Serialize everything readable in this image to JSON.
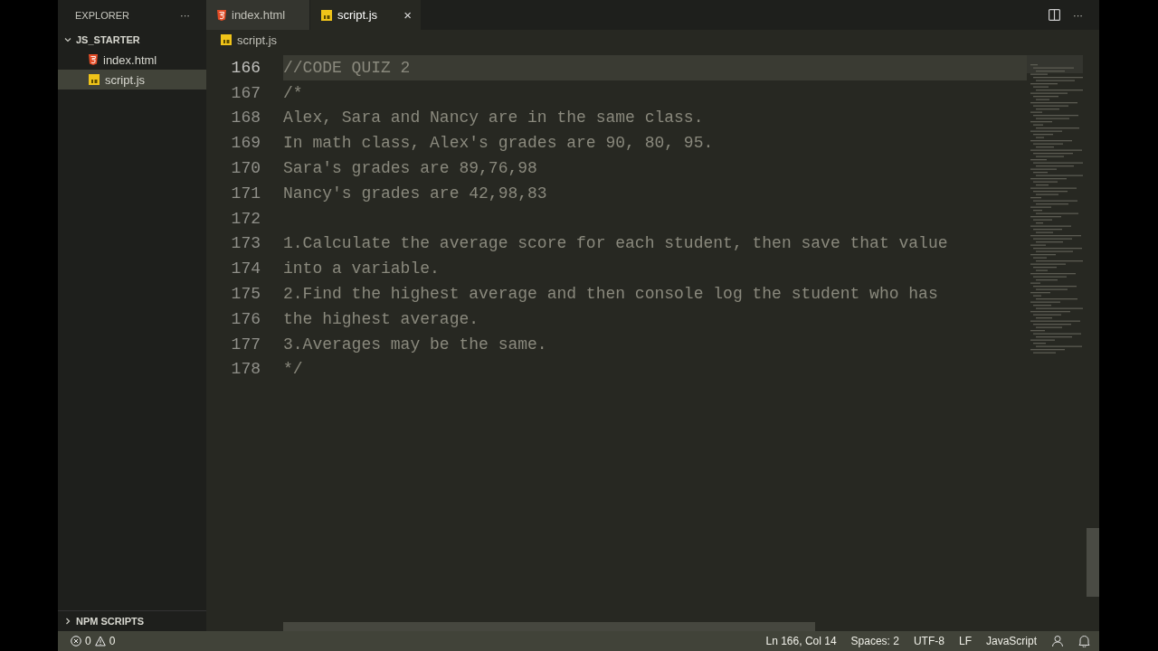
{
  "sidebar": {
    "title": "EXPLORER",
    "more": "···",
    "folder": {
      "name": "JS_STARTER",
      "expanded": true,
      "children": [
        {
          "name": "index.html",
          "kind": "html",
          "selected": false
        },
        {
          "name": "script.js",
          "kind": "js",
          "selected": true
        }
      ]
    },
    "npm_scripts": {
      "name": "NPM SCRIPTS",
      "expanded": false
    }
  },
  "tabs": [
    {
      "label": "index.html",
      "kind": "html",
      "selected": false
    },
    {
      "label": "script.js",
      "kind": "js",
      "selected": true,
      "close": "×"
    }
  ],
  "editor_actions": {
    "more": "···"
  },
  "breadcrumb": {
    "label": "script.js",
    "kind": "js"
  },
  "lines": [
    {
      "number": "166",
      "text": "//CODE QUIZ 2",
      "current": true
    },
    {
      "number": "167",
      "text": "/*",
      "current": false
    },
    {
      "number": "168",
      "text": "Alex, Sara and Nancy are in the same class.",
      "current": false
    },
    {
      "number": "169",
      "text": "In math class, Alex's grades are 90, 80, 95.",
      "current": false
    },
    {
      "number": "170",
      "text": "Sara's grades are 89,76,98",
      "current": false
    },
    {
      "number": "171",
      "text": "Nancy's grades are 42,98,83",
      "current": false
    },
    {
      "number": "172",
      "current": false
    },
    {
      "number": "173",
      "text": "1.Calculate the average score for each student, then save that value",
      "current": false
    },
    {
      "number": "174",
      "text": "into a variable.",
      "current": false
    },
    {
      "number": "175",
      "text": "2.Find the highest average and then console log the student who has",
      "current": false
    },
    {
      "number": "176",
      "text": "the highest average.",
      "current": false
    },
    {
      "number": "177",
      "text": "3.Averages may be the same.",
      "current": false
    },
    {
      "number": "178",
      "text": "*/",
      "current": false
    }
  ],
  "status_bar": {
    "errors": "0",
    "warnings": "0",
    "items": [
      "Ln 166, Col 14",
      "Spaces: 2",
      "UTF-8",
      "LF",
      "JavaScript"
    ]
  }
}
